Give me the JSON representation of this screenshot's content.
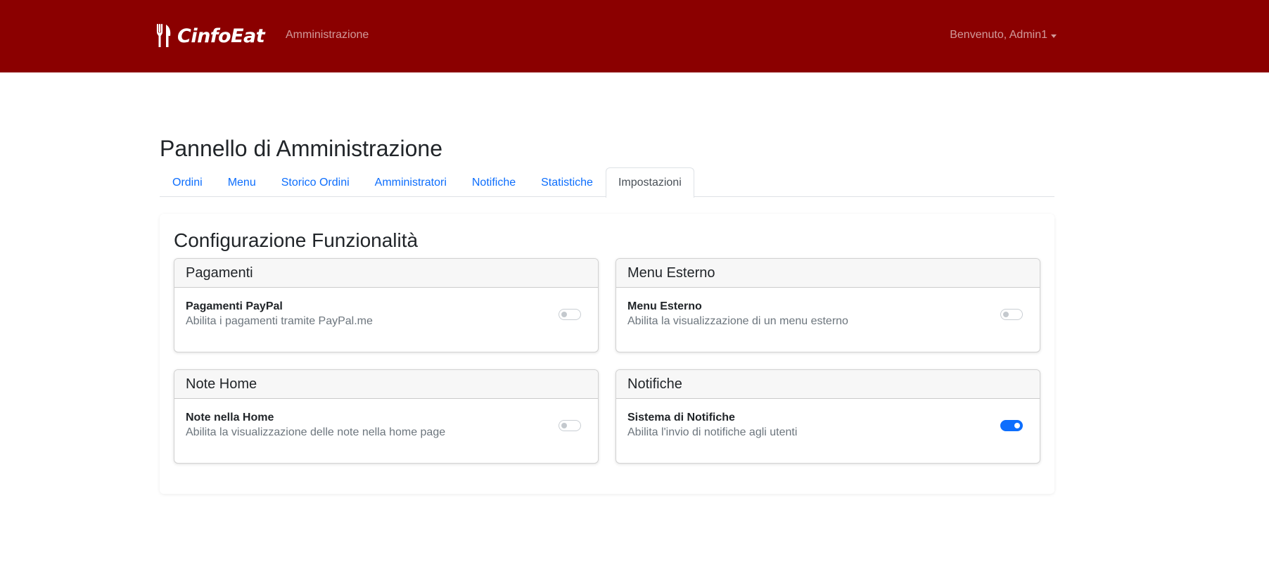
{
  "navbar": {
    "brand": "CinfoEat",
    "brand_icon": "fork-knife-icon",
    "admin_link": "Amministrazione",
    "user_menu": "Benvenuto, Admin1",
    "background": "#8b0000"
  },
  "page": {
    "title": "Pannello di Amministrazione"
  },
  "tabs": [
    {
      "label": "Ordini",
      "active": false
    },
    {
      "label": "Menu",
      "active": false
    },
    {
      "label": "Storico Ordini",
      "active": false
    },
    {
      "label": "Amministratori",
      "active": false
    },
    {
      "label": "Notifiche",
      "active": false
    },
    {
      "label": "Statistiche",
      "active": false
    },
    {
      "label": "Impostazioni",
      "active": true
    }
  ],
  "settings": {
    "title": "Configurazione Funzionalità",
    "cards": [
      {
        "header": "Pagamenti",
        "label": "Pagamenti PayPal",
        "description": "Abilita i pagamenti tramite PayPal.me",
        "enabled": false
      },
      {
        "header": "Menu Esterno",
        "label": "Menu Esterno",
        "description": "Abilita la visualizzazione di un menu esterno",
        "enabled": false
      },
      {
        "header": "Note Home",
        "label": "Note nella Home",
        "description": "Abilita la visualizzazione delle note nella home page",
        "enabled": false
      },
      {
        "header": "Notifiche",
        "label": "Sistema di Notifiche",
        "description": "Abilita l'invio di notifiche agli utenti",
        "enabled": true
      }
    ]
  },
  "colors": {
    "accent": "#0d6efd",
    "link": "#0d6efd"
  }
}
